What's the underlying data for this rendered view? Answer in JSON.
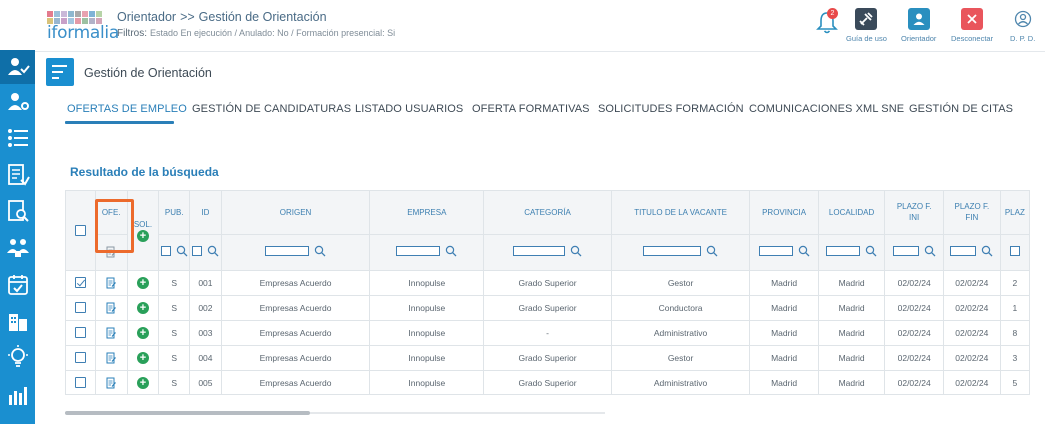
{
  "app": {
    "logo_text": "iformalia",
    "breadcrumb": [
      "Orientador",
      ">>",
      "Gestión de Orientación"
    ],
    "filters_label": "Filtros:",
    "filters_value": "Estado En ejecución / Anulado: No / Formación presencial: Si",
    "notification_count": "2"
  },
  "header_buttons": [
    {
      "label": "Guía de uso",
      "icon": "tools-icon",
      "color": "#3a4a5a"
    },
    {
      "label": "Orientador",
      "icon": "user-icon",
      "color": "#2a8fbf"
    },
    {
      "label": "Desconectar",
      "icon": "close-icon",
      "color": "#e9555c"
    },
    {
      "label": "D. P. D.",
      "icon": "user-circle-icon",
      "color": "#4f86ad"
    }
  ],
  "page": {
    "title": "Gestión de Orientación"
  },
  "tabs": [
    {
      "label": "OFERTAS DE EMPLEO",
      "active": true
    },
    {
      "label": "GESTIÓN DE CANDIDATURAS"
    },
    {
      "label": "LISTADO USUARIOS"
    },
    {
      "label": "OFERTA FORMATIVAS"
    },
    {
      "label": "SOLICITUDES FORMACIÓN"
    },
    {
      "label": "COMUNICACIONES XML SNE"
    },
    {
      "label": "GESTIÓN DE CITAS"
    }
  ],
  "results": {
    "title": "Resultado de la búsqueda"
  },
  "table": {
    "columns": [
      "",
      "OFE.",
      "SOL.",
      "PUB.",
      "ID",
      "ORIGEN",
      "EMPRESA",
      "CATEGORÍA",
      "TITULO DE LA VACANTE",
      "PROVINCIA",
      "LOCALIDAD",
      "PLAZO F. INI",
      "PLAZO F. FIN",
      "PLAZ"
    ],
    "rows": [
      {
        "checked": true,
        "pub": "S",
        "id": "001",
        "origen": "Empresas Acuerdo",
        "empresa": "Innopulse",
        "categoria": "Grado Superior",
        "titulo": "Gestor",
        "provincia": "Madrid",
        "localidad": "Madrid",
        "ini": "02/02/24",
        "fin": "02/02/24",
        "extra": "2"
      },
      {
        "checked": false,
        "pub": "S",
        "id": "002",
        "origen": "Empresas Acuerdo",
        "empresa": "Innopulse",
        "categoria": "Grado Superior",
        "titulo": "Conductora",
        "provincia": "Madrid",
        "localidad": "Madrid",
        "ini": "02/02/24",
        "fin": "02/02/24",
        "extra": "1"
      },
      {
        "checked": false,
        "pub": "S",
        "id": "003",
        "origen": "Empresas Acuerdo",
        "empresa": "Innopulse",
        "categoria": "-",
        "titulo": "Administrativo",
        "provincia": "Madrid",
        "localidad": "Madrid",
        "ini": "02/02/24",
        "fin": "02/02/24",
        "extra": "8"
      },
      {
        "checked": false,
        "pub": "S",
        "id": "004",
        "origen": "Empresas Acuerdo",
        "empresa": "Innopulse",
        "categoria": "Grado Superior",
        "titulo": "Gestor",
        "provincia": "Madrid",
        "localidad": "Madrid",
        "ini": "02/02/24",
        "fin": "02/02/24",
        "extra": "3"
      },
      {
        "checked": false,
        "pub": "S",
        "id": "005",
        "origen": "Empresas Acuerdo",
        "empresa": "Innopulse",
        "categoria": "Grado Superior",
        "titulo": "Administrativo",
        "provincia": "Madrid",
        "localidad": "Madrid",
        "ini": "02/02/24",
        "fin": "02/02/24",
        "extra": "5"
      }
    ]
  },
  "sidebar_icons": [
    "user-check-icon",
    "user-cog-icon",
    "list-icon",
    "report-icon",
    "search-doc-icon",
    "group-icon",
    "calendar-check-icon",
    "building-icon",
    "lightbulb-icon",
    "chart-icon"
  ],
  "colors": {
    "accent": "#1a8fd0",
    "highlight": "#ec6a2c",
    "add": "#2aa05a"
  }
}
